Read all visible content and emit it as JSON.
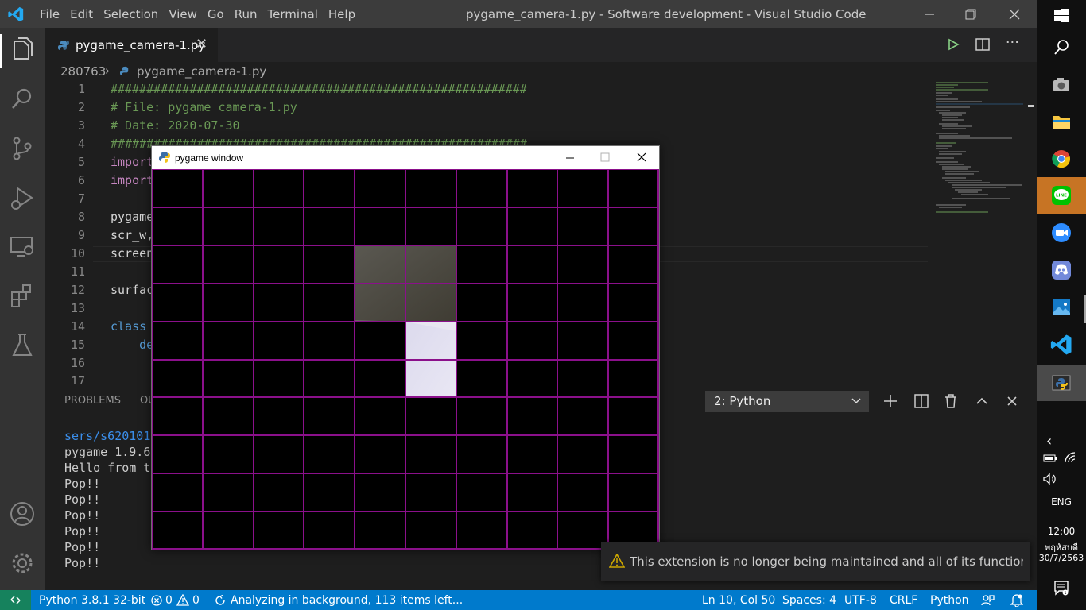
{
  "window": {
    "title": "pygame_camera-1.py - Software development - Visual Studio Code",
    "menu": [
      "File",
      "Edit",
      "Selection",
      "View",
      "Go",
      "Run",
      "Terminal",
      "Help"
    ]
  },
  "tab": {
    "filename": "pygame_camera-1.py"
  },
  "breadcrumb": {
    "folder": "280763",
    "file": "pygame_camera-1.py"
  },
  "editor": {
    "lines": [
      {
        "n": "1",
        "text": "##########################################################"
      },
      {
        "n": "2",
        "text": "# File: pygame_camera-1.py"
      },
      {
        "n": "3",
        "text": "# Date: 2020-07-30"
      },
      {
        "n": "4",
        "text": "##########################################################"
      },
      {
        "n": "5",
        "text": "import"
      },
      {
        "n": "6",
        "text": "import"
      },
      {
        "n": "7",
        "text": ""
      },
      {
        "n": "8",
        "text": "pygame"
      },
      {
        "n": "9",
        "text": "scr_w,"
      },
      {
        "n": "10",
        "text": "screen"
      },
      {
        "n": "11",
        "text": ""
      },
      {
        "n": "12",
        "text": "surfac"
      },
      {
        "n": "13",
        "text": ""
      },
      {
        "n": "14",
        "text": "class "
      },
      {
        "n": "15",
        "text": "    de"
      },
      {
        "n": "16",
        "text": ""
      },
      {
        "n": "17",
        "text": ""
      }
    ]
  },
  "panel": {
    "tabs": [
      "PROBLEMS",
      "OU"
    ],
    "terminal_select": "2: Python",
    "terminal_lines": [
      "sers/s620101",
      "pygame 1.9.6",
      "Hello from t",
      "Pop!!",
      "Pop!!",
      "Pop!!",
      "Pop!!",
      "Pop!!",
      "Pop!!"
    ]
  },
  "pygame_window": {
    "title": "pygame window",
    "grid_cols": 10,
    "grid_rows": 10,
    "grid_color": "#8b108b"
  },
  "notification": {
    "message": "This extension is no longer being maintained and all of its functionalit..."
  },
  "statusbar": {
    "interpreter": "Python 3.8.1 32-bit",
    "errors": "0",
    "warnings": "0",
    "analysis": "Analyzing in background, 113 items left...",
    "position": "Ln 10, Col 50",
    "spaces": "Spaces: 4",
    "encoding": "UTF-8",
    "eol": "CRLF",
    "language": "Python"
  },
  "taskbar": {
    "language": "ENG",
    "time": "12:00",
    "day": "พฤหัสบดี",
    "date": "30/7/2563"
  },
  "colors": {
    "accent": "#007acc",
    "activity_bar": "#333333",
    "editor_bg": "#1e1e1e",
    "comment": "#6a9955",
    "keyword": "#569cd6"
  }
}
